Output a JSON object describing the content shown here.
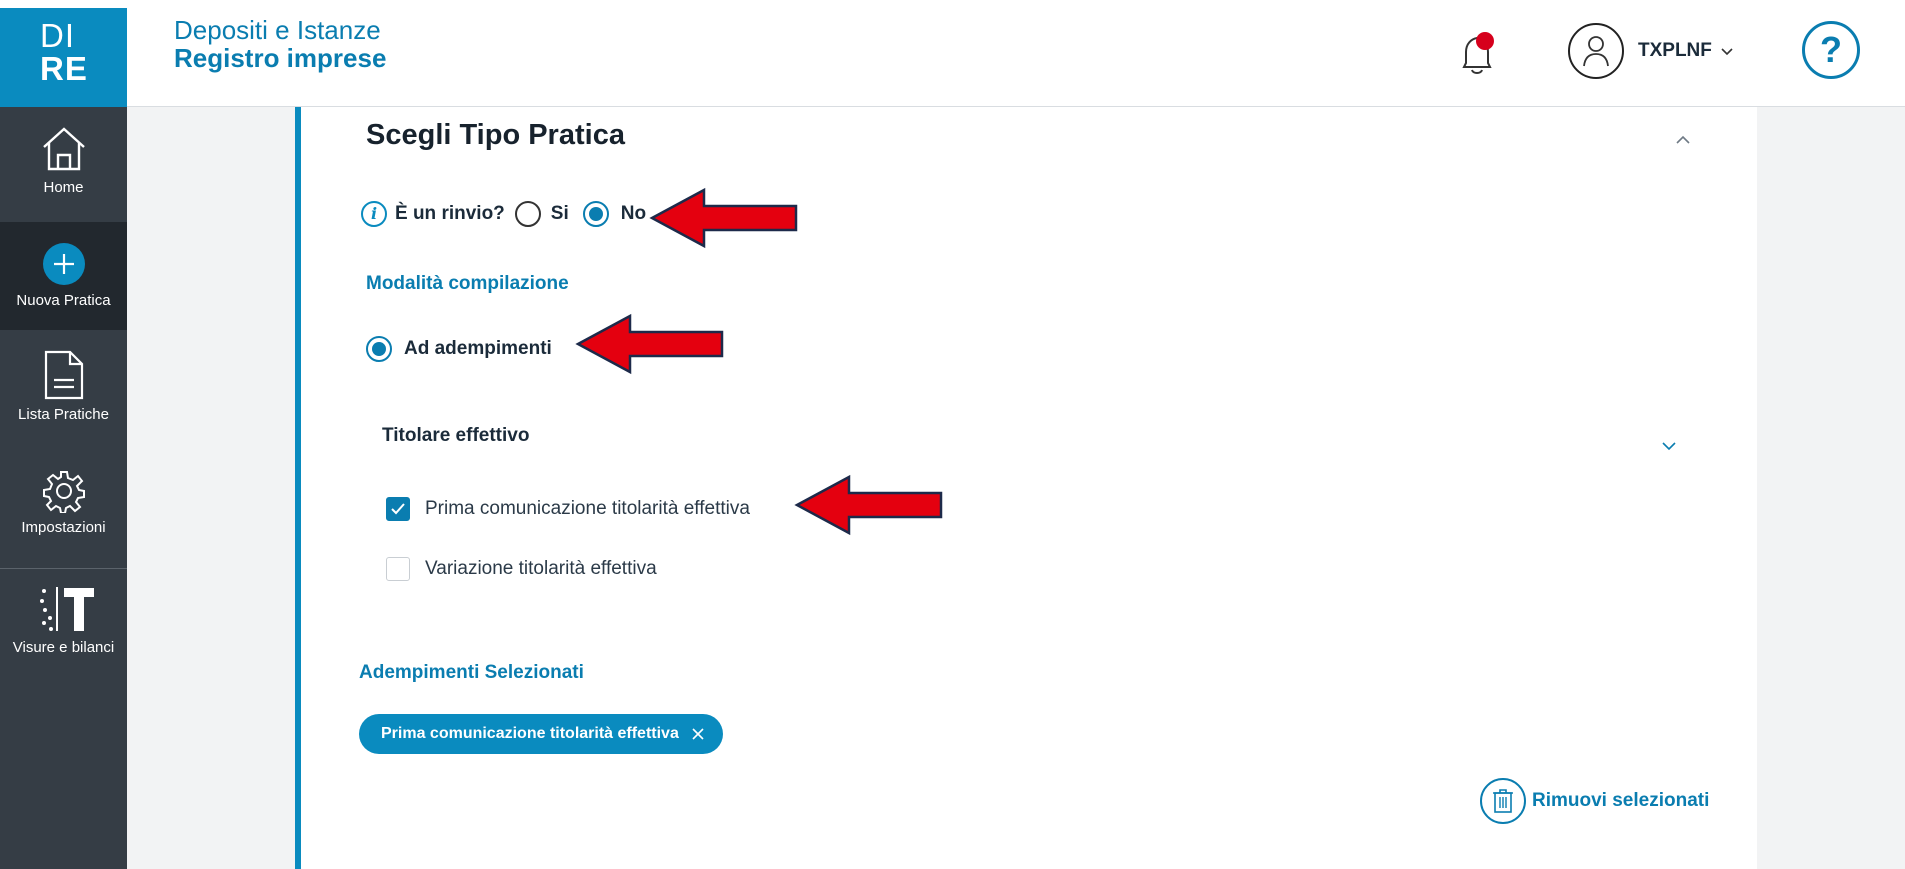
{
  "header": {
    "logo_line1": "DI",
    "logo_line2": "RE",
    "title_line1": "Depositi e Istanze",
    "title_line2": "Registro imprese",
    "user_name": "TXPLNF",
    "help_label": "?",
    "notification_badge_color": "#d6001c",
    "accent_color": "#0a8bbf"
  },
  "sidebar": {
    "items": [
      {
        "label": "Home",
        "icon": "home-icon"
      },
      {
        "label": "Nuova Pratica",
        "icon": "plus-circle-icon",
        "active": true
      },
      {
        "label": "Lista Pratiche",
        "icon": "document-icon"
      },
      {
        "label": "Impostazioni",
        "icon": "gear-icon"
      },
      {
        "label": "Visure e bilanci",
        "icon": "visure-logo-icon"
      }
    ]
  },
  "main": {
    "card_title": "Scegli Tipo Pratica",
    "rinvio_question": "È un rinvio?",
    "rinvio_options": [
      {
        "label": "Si",
        "selected": false
      },
      {
        "label": "No",
        "selected": true
      }
    ],
    "modalita_label": "Modalità compilazione",
    "modalita_option": {
      "label": "Ad adempimenti",
      "selected": true
    },
    "group_title": "Titolare effettivo",
    "checkboxes": [
      {
        "label": "Prima comunicazione titolarità effettiva",
        "checked": true
      },
      {
        "label": "Variazione titolarità effettiva",
        "checked": false
      }
    ],
    "selected_section_label": "Adempimenti Selezionati",
    "selected_chips": [
      "Prima comunicazione titolarità effettiva"
    ],
    "remove_button_label": "Rimuovi selezionati"
  },
  "annotations": {
    "arrow_color": "#e4000f"
  }
}
